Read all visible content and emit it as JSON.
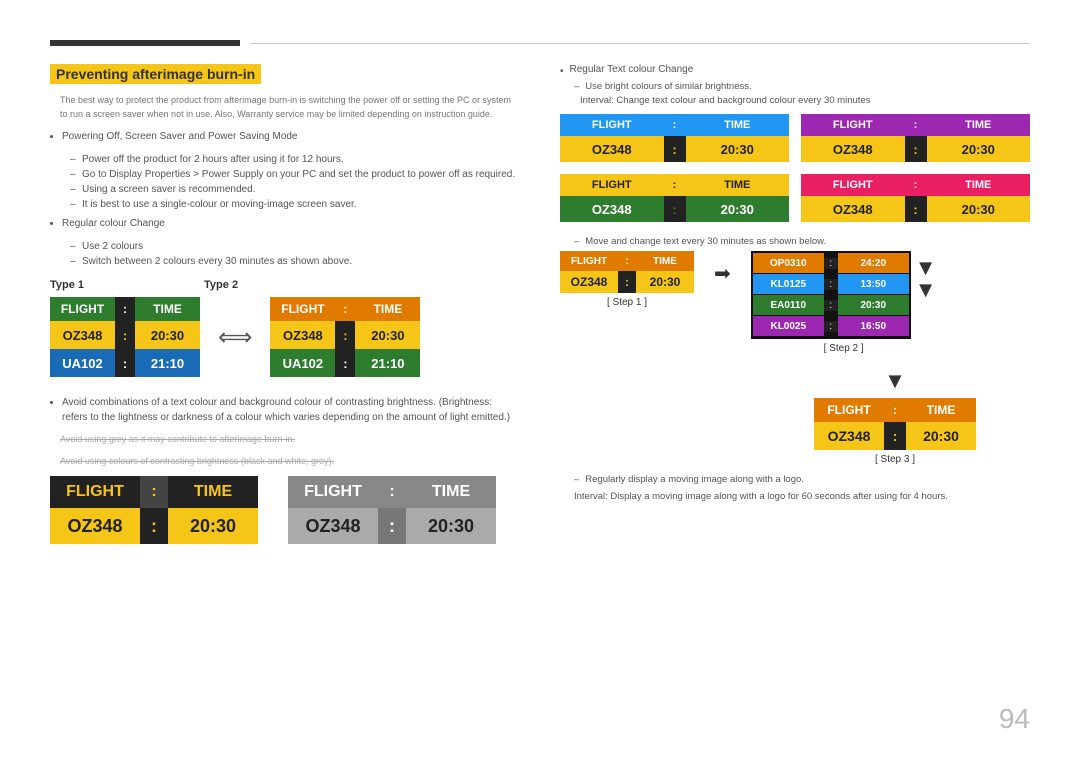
{
  "page": {
    "number": "94"
  },
  "header": {
    "section_title": "Preventing afterimage burn-in"
  },
  "left": {
    "intro": "The best way to protect the product from afterimage burn-in is switching the power off or setting the PC or system to run a screen saver when not in use. Also, Warranty service may be limited depending on instruction guide.",
    "bullet1": "Powering Off, Screen Saver and Power Saving Mode",
    "bullet1_dashes": [
      "Power off the product for 2 hours after using it for 12 hours.",
      "Go to Display Properties > Power Supply on your PC and set the product to power off as required.",
      "Using a screen saver is recommended.",
      "It is best to use a single-colour or moving-image screen saver."
    ],
    "bullet2": "Regular colour Change",
    "bullet2_dashes": [
      "Use 2 colours",
      "Switch between 2 colours every 30 minutes as shown above."
    ],
    "type1_label": "Type 1",
    "type2_label": "Type 2",
    "type1_board": {
      "header": [
        "FLIGHT",
        ":",
        "TIME"
      ],
      "row1": [
        "OZ348",
        ":",
        "20:30"
      ],
      "row2": [
        "UA102",
        ":",
        "21:10"
      ]
    },
    "type2_board": {
      "header": [
        "FLIGHT",
        ":",
        "TIME"
      ],
      "row1": [
        "OZ348",
        ":",
        "20:30"
      ],
      "row2": [
        "UA102",
        ":",
        "21:10"
      ]
    },
    "bullet3": "Avoid combinations of a text colour and background colour of contrasting brightness. (Brightness: refers to the lightness or darkness of a colour which varies depending on the amount of light emitted.)",
    "note1": "Avoid using grey as it may contribute to afterimage burn-in.",
    "note2": "Avoid using colours of contrasting brightness (black and white; grey).",
    "bottom_board1": {
      "header": [
        "FLIGHT",
        ":",
        "TIME"
      ],
      "row1": [
        "OZ348",
        ":",
        "20:30"
      ]
    },
    "bottom_board2": {
      "header": [
        "FLIGHT",
        ":",
        "TIME"
      ],
      "row1": [
        "OZ348",
        ":",
        "20:30"
      ]
    }
  },
  "right": {
    "bullet1": "Regular Text colour Change",
    "dash1": "Use bright colours of similar brightness.",
    "dash2": "Interval: Change text colour and background colour every 30 minutes",
    "boards": [
      {
        "header": [
          "FLIGHT",
          ":",
          "TIME"
        ],
        "row1": [
          "OZ348",
          ":",
          "20:30"
        ],
        "style": "sv1"
      },
      {
        "header": [
          "FLIGHT",
          ":",
          "TIME"
        ],
        "row1": [
          "OZ348",
          ":",
          "20:30"
        ],
        "style": "sv2"
      },
      {
        "header": [
          "FLIGHT",
          ":",
          "TIME"
        ],
        "row1": [
          "OZ348",
          ":",
          "20:30"
        ],
        "style": "sv3"
      },
      {
        "header": [
          "FLIGHT",
          ":",
          "TIME"
        ],
        "row1": [
          "OZ348",
          ":",
          "20:30"
        ],
        "style": "sv4"
      }
    ],
    "steps_dash": "Move and change text every 30 minutes as shown below.",
    "step1_label": "[ Step 1 ]",
    "step2_label": "[ Step 2 ]",
    "step3_label": "[ Step 3 ]",
    "step1_board": {
      "header": [
        "FLIGHT",
        ":",
        "TIME"
      ],
      "row1": [
        "OZ348",
        ":",
        "20:30"
      ]
    },
    "step2_flights": [
      [
        "OP0310",
        ":",
        "24:20"
      ],
      [
        "KL0125",
        ":",
        "13:50"
      ],
      [
        "EA0110",
        ":",
        "20:30"
      ],
      [
        "KL0025",
        ":",
        "16:50"
      ]
    ],
    "step3_board": {
      "header": [
        "FLIGHT",
        ":",
        "TIME"
      ],
      "row1": [
        "OZ348",
        ":",
        "20:30"
      ]
    },
    "final_dash": "Regularly display a moving image along with a logo.",
    "final_text": "Interval: Display a moving image along with a logo for 60 seconds after using for 4 hours."
  }
}
